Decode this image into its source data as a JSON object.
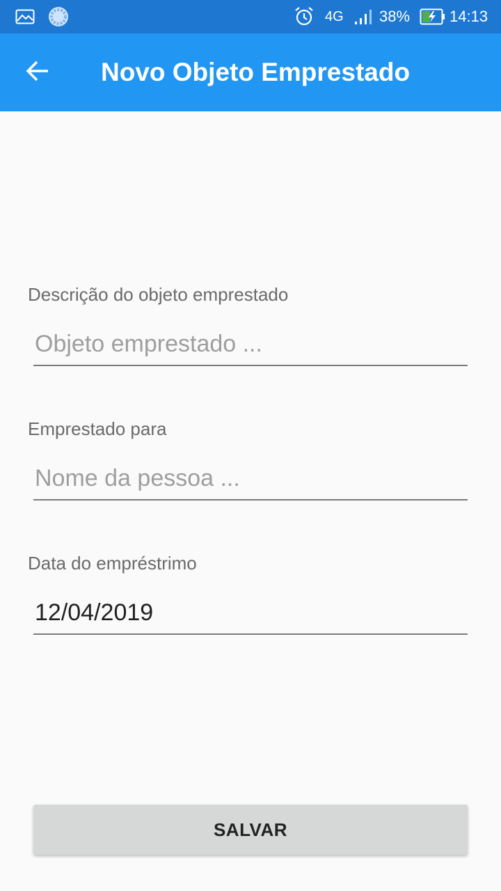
{
  "status_bar": {
    "network": "4G",
    "battery": "38%",
    "time": "14:13",
    "icons": [
      "image-notification-icon",
      "sync-notification-icon",
      "alarm-icon",
      "signal-icon",
      "battery-charging-icon"
    ]
  },
  "app_bar": {
    "title": "Novo Objeto Emprestado",
    "back_icon": "arrow-back-icon"
  },
  "form": {
    "description": {
      "label": "Descrição do objeto emprestado",
      "placeholder": "Objeto emprestado ...",
      "value": ""
    },
    "borrower": {
      "label": "Emprestado para",
      "placeholder": "Nome da pessoa ...",
      "value": ""
    },
    "date": {
      "label": "Data do empréstrimo",
      "placeholder": "",
      "value": "12/04/2019"
    },
    "save_label": "SALVAR"
  },
  "colors": {
    "status_bar": "#1e78d2",
    "app_bar": "#2196f3",
    "background": "#fafafa",
    "button": "#d6d7d7",
    "battery_fill": "#4caf50"
  }
}
